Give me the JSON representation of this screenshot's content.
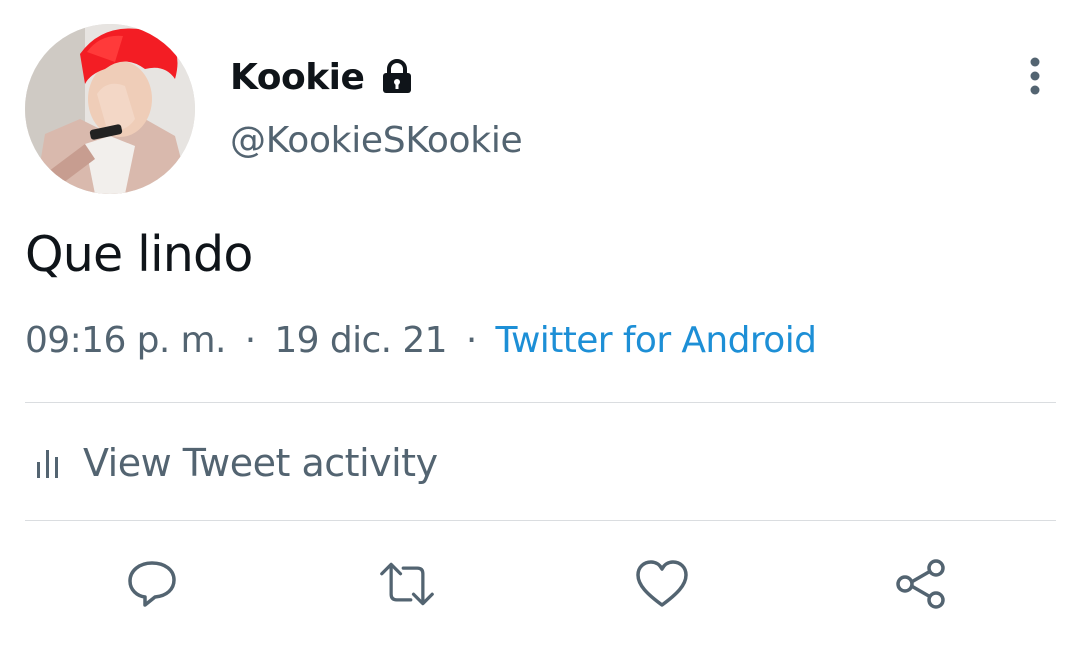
{
  "user": {
    "display_name": "Kookie",
    "handle": "@KookieSKookie",
    "protected_icon": "lock-icon",
    "avatar_icon": "profile-photo"
  },
  "tweet": {
    "text": "Que lindo",
    "time": "09:16 p. m.",
    "separator": "·",
    "date": "19 dic. 21",
    "source": "Twitter for Android"
  },
  "activity": {
    "label": "View Tweet activity",
    "icon": "analytics-icon"
  },
  "actions": [
    {
      "name": "reply",
      "icon": "reply-icon"
    },
    {
      "name": "retweet",
      "icon": "retweet-icon"
    },
    {
      "name": "like",
      "icon": "heart-icon"
    },
    {
      "name": "share",
      "icon": "share-icon"
    }
  ],
  "menu": {
    "icon": "more-vertical-icon"
  },
  "colors": {
    "text": "#0f1419",
    "secondary": "#536471",
    "link": "#1d8fd6",
    "divider": "#dadde0",
    "icon": "#536471"
  }
}
